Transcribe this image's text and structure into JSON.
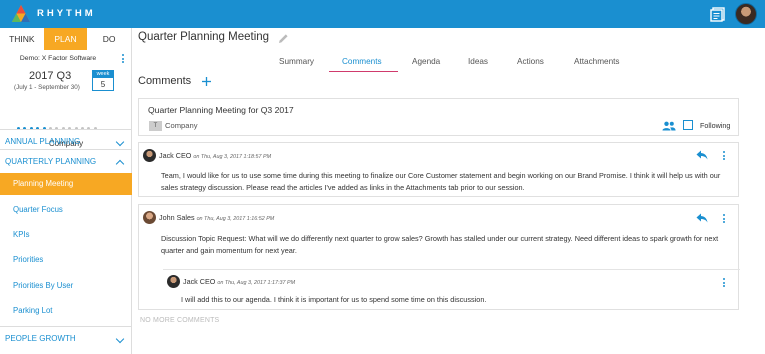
{
  "brand": {
    "name": "RHYTHM"
  },
  "sidebar": {
    "phases": [
      {
        "label": "THINK",
        "active": false
      },
      {
        "label": "PLAN",
        "active": true
      },
      {
        "label": "DO",
        "active": false
      }
    ],
    "company_name": "Demo: X Factor Software",
    "quarter": "2017 Q3",
    "quarter_dates": "(July 1 - September 30)",
    "week_label": "week",
    "week_number": "5",
    "weeks_total": 13,
    "weeks_elapsed": 5,
    "company_label": "Company",
    "sections": {
      "annual": "ANNUAL PLANNING",
      "quarterly": "QUARTERLY PLANNING",
      "people": "PEOPLE GROWTH"
    },
    "quarterly_items": [
      {
        "label": "Planning Meeting",
        "active": true
      },
      {
        "label": "Quarter Focus",
        "active": false
      },
      {
        "label": "KPIs",
        "active": false
      },
      {
        "label": "Priorities",
        "active": false
      },
      {
        "label": "Priorities By User",
        "active": false
      },
      {
        "label": "Parking Lot",
        "active": false
      }
    ]
  },
  "main": {
    "title": "Quarter Planning Meeting",
    "tabs": [
      {
        "label": "Summary",
        "active": false
      },
      {
        "label": "Comments",
        "active": true
      },
      {
        "label": "Agenda",
        "active": false
      },
      {
        "label": "Ideas",
        "active": false
      },
      {
        "label": "Actions",
        "active": false
      },
      {
        "label": "Attachments",
        "active": false
      }
    ],
    "comments_heading": "Comments",
    "thread_header": {
      "title": "Quarter Planning Meeting for Q3 2017",
      "badge": "T",
      "scope": "Company",
      "following_label": "Following"
    },
    "comments": [
      {
        "author": "Jack CEO",
        "date": "on Thu, Aug 3, 2017 1:18:57 PM",
        "text": "Team, I would like for us to use some time during this meeting to finalize our Core Customer statement and begin working on our Brand Promise. I think it will help us with our sales strategy discussion. Please read the articles I've added as links in the Attachments tab prior to our session."
      },
      {
        "author": "John Sales",
        "date": "on Thu, Aug 3, 2017 1:16:52 PM",
        "text": "Discussion Topic Request: What will we do differently next quarter to grow sales? Growth has stalled under our current strategy. Need different ideas to spark growth for next quarter and gain momentum for next year.",
        "replies": [
          {
            "author": "Jack CEO",
            "date": "on Thu, Aug 3, 2017 1:17:37 PM",
            "text": "I will add this to our agenda. I think it is important for us to spend some time on this discussion."
          }
        ]
      }
    ],
    "no_more_label": "NO MORE COMMENTS"
  },
  "colors": {
    "brand_blue": "#1a8fd0",
    "accent_orange": "#f7a823",
    "tab_underline": "#d03a6c"
  }
}
